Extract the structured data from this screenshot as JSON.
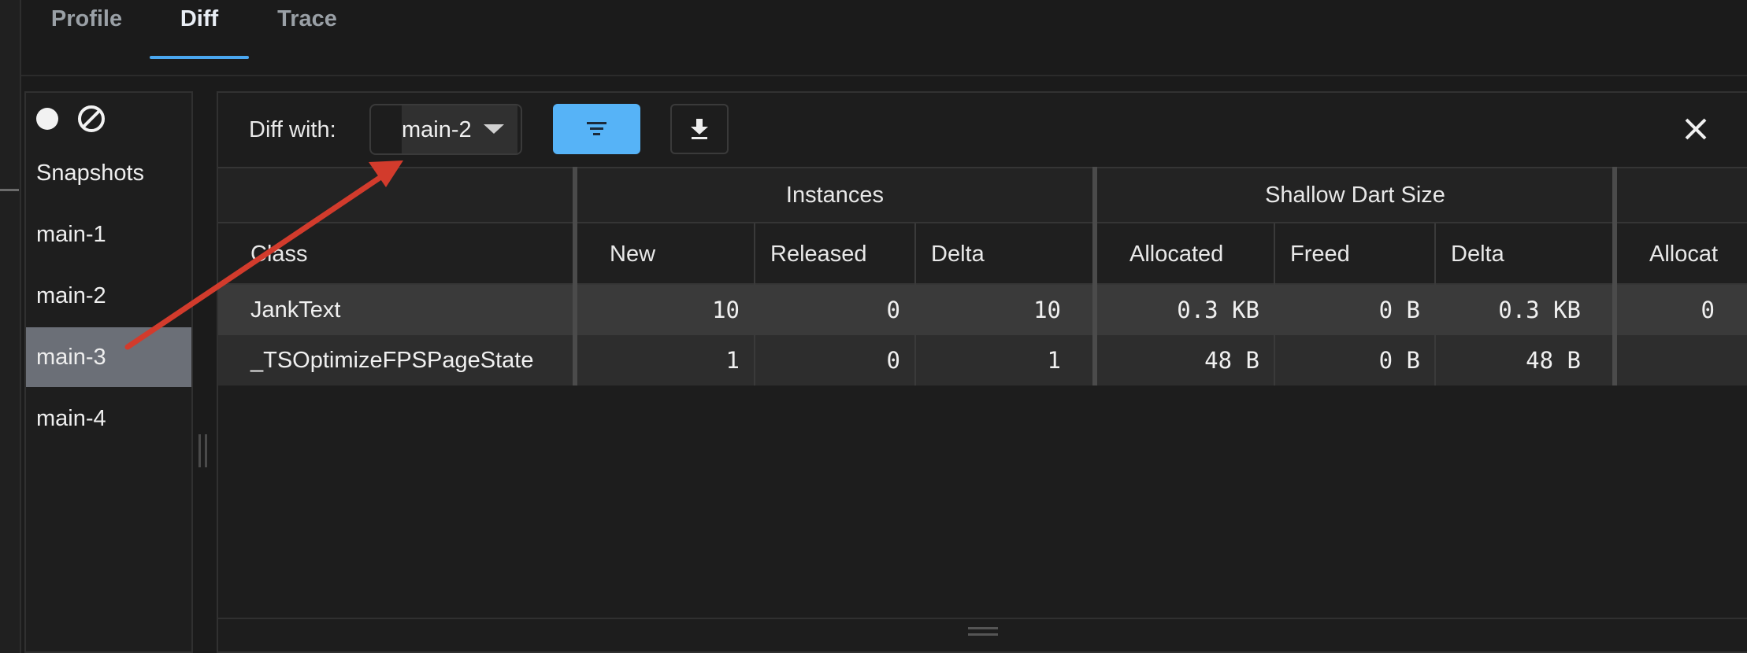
{
  "tabs": [
    {
      "label": "Profile",
      "active": false
    },
    {
      "label": "Diff",
      "active": true
    },
    {
      "label": "Trace",
      "active": false
    }
  ],
  "sidebar": {
    "heading": "Snapshots",
    "items": [
      {
        "label": "main-1",
        "selected": false
      },
      {
        "label": "main-2",
        "selected": false
      },
      {
        "label": "main-3",
        "selected": true
      },
      {
        "label": "main-4",
        "selected": false
      }
    ],
    "icons": [
      "record-icon",
      "clear-icon"
    ]
  },
  "toolbar": {
    "diff_with_label": "Diff with:",
    "diff_with_value": "main-2",
    "filter_icon": "filter-icon",
    "download_icon": "download-icon",
    "close_icon": "close-icon"
  },
  "table": {
    "group_headers": [
      "Instances",
      "Shallow Dart Size"
    ],
    "columns": [
      "Class",
      "New",
      "Released",
      "Delta",
      "Allocated",
      "Freed",
      "Delta",
      "Allocat"
    ],
    "rows": [
      {
        "class": "JankText",
        "new": "10",
        "released": "0",
        "delta": "10",
        "allocated": "0.3 KB",
        "freed": "0 B",
        "size_delta": "0.3 KB",
        "extra": "0"
      },
      {
        "class": "_TSOptimizeFPSPageState",
        "new": "1",
        "released": "0",
        "delta": "1",
        "allocated": "48 B",
        "freed": "0 B",
        "size_delta": "48 B",
        "extra": ""
      }
    ]
  },
  "colors": {
    "accent": "#4aa7f0",
    "filter_button": "#56b3f7",
    "selected_item": "#6b6f77",
    "annotation_arrow": "#d23b2c"
  }
}
